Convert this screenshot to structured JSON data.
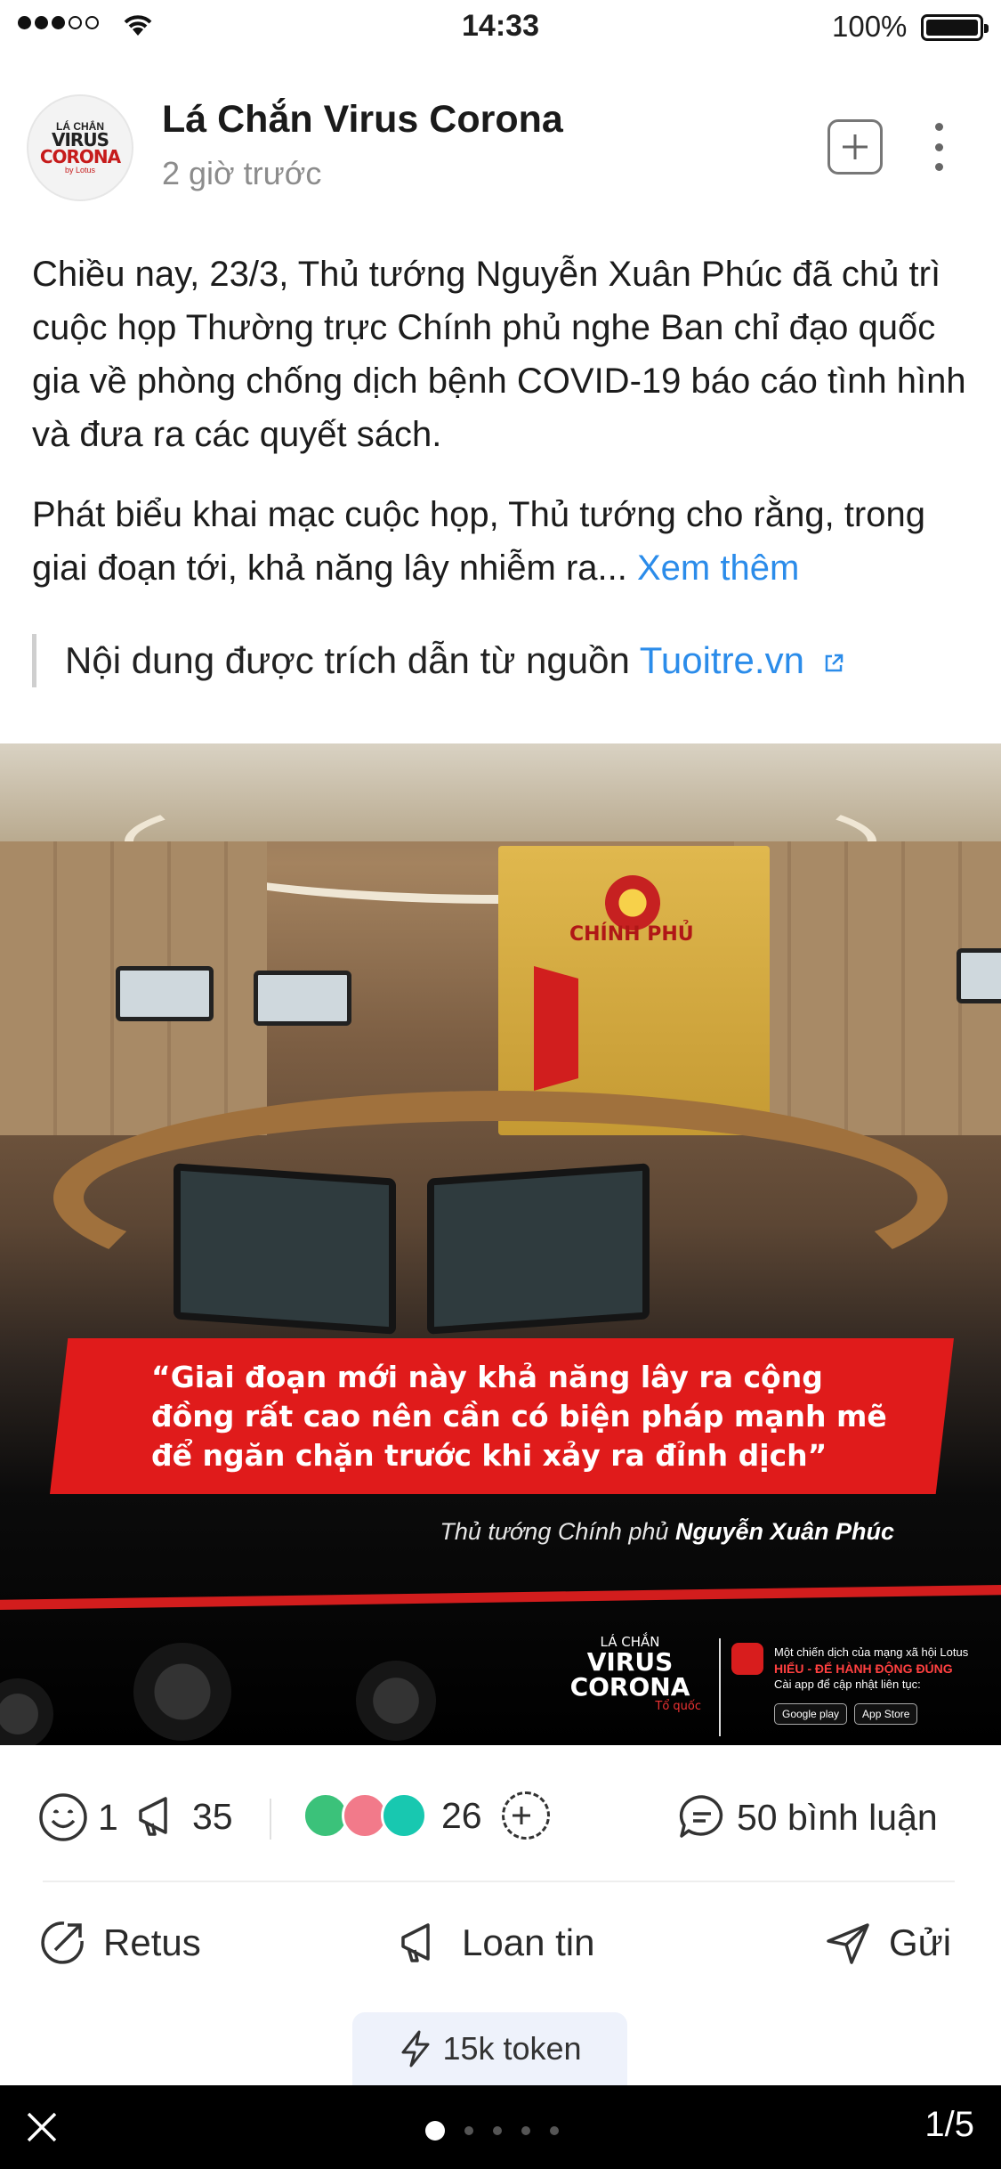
{
  "status_bar": {
    "time": "14:33",
    "battery": "100%"
  },
  "post": {
    "page_name": "Lá Chắn Virus Corona",
    "time_ago": "2 giờ trước",
    "avatar_lines": [
      "LÁ CHẮN",
      "VIRUS",
      "CORONA",
      "by Lotus"
    ],
    "paragraph1": "Chiều nay, 23/3, Thủ tướng Nguyễn Xuân Phúc đã chủ trì cuộc họp Thường trực Chính phủ nghe Ban chỉ đạo quốc gia về phòng chống dịch bệnh COVID-19 báo cáo tình hình và đưa ra các quyết sách.",
    "paragraph2": "Phát biểu khai mạc cuộc họp, Thủ tướng cho rằng, trong giai đoạn tới, khả năng lây nhiễm ra...",
    "see_more": "Xem thêm",
    "source_prefix": "Nội dung được trích dẫn từ nguồn",
    "source_name": "Tuoitre.vn"
  },
  "image": {
    "gov_label": "CHÍNH PHỦ",
    "quote_lines": [
      "“Giai đoạn mới này khả năng lây ra cộng",
      "đồng rất cao nên cần có biện pháp mạnh mẽ",
      "để ngăn chặn trước khi xảy ra đỉnh dịch”"
    ],
    "quote_author_prefix": "Thủ tướng Chính phủ",
    "quote_author_name": "Nguyễn Xuân Phúc",
    "campaign_logo": [
      "LÁ CHẮN",
      "VIRUS",
      "CORONA",
      "Tổ quốc"
    ],
    "campaign_info": "Một chiến dịch của mạng xã hội Lotus",
    "campaign_highlight": "HIỂU - ĐỂ HÀNH ĐỘNG ĐÚNG",
    "campaign_sub": "Cài app để cập nhật liên tục:",
    "store_google": "Google play",
    "store_apple": "App Store"
  },
  "reactions": {
    "smile_count": "1",
    "share_count": "35",
    "emotion_count": "26",
    "comments": "50 bình luận"
  },
  "actions": {
    "retus": "Retus",
    "loan_tin": "Loan tin",
    "gui": "Gửi"
  },
  "token": "15k token",
  "pager": {
    "total_dots": 5,
    "active_index": 0,
    "page_count": "1/5"
  },
  "colors": {
    "link": "#2b8cea",
    "banner_red": "#e01b1b",
    "bottom_bar": "#000000"
  },
  "icons": [
    "signal-icon",
    "wifi-icon",
    "battery-icon",
    "add-icon",
    "more-icon",
    "external-link-icon",
    "smile-icon",
    "megaphone-icon",
    "comment-icon",
    "retus-icon",
    "send-icon",
    "lightning-icon",
    "close-icon"
  ]
}
